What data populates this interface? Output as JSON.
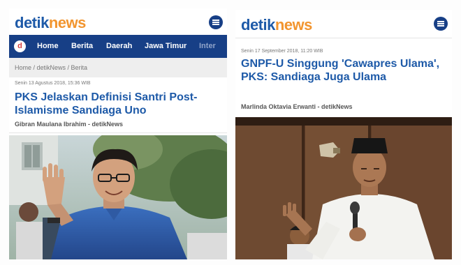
{
  "left_article": {
    "logo": {
      "detik": "detik",
      "news": "news"
    },
    "nav": {
      "logo_letter": "d",
      "items": [
        "Home",
        "Berita",
        "Daerah",
        "Jawa Timur",
        "Inter"
      ]
    },
    "breadcrumb": "Home / detikNews / Berita",
    "date": "Senin 13 Agustus 2018, 15:36 WIB",
    "headline": "PKS Jelaskan Definisi Santri Post-Islamisme Sandiaga Uno",
    "author": "Gibran Maulana Ibrahim - detikNews",
    "photo": "photo of smiling man in blue polo shirt waving"
  },
  "right_article": {
    "logo": {
      "detik": "detik",
      "news": "news"
    },
    "date": "Senin 17 September 2018, 11:20 WIB",
    "headline": "GNPF-U Singgung 'Cawapres Ulama', PKS: Sandiaga Juga Ulama",
    "author": "Marlinda Oktavia Erwanti - detikNews",
    "photo": "photo of man in white clothing and black cap speaking into microphone"
  },
  "colors": {
    "brand_blue": "#1e5aa8",
    "brand_orange": "#f2952f",
    "navbar_blue": "#173f86"
  },
  "icons": [
    "menu-icon",
    "detik-logo-icon"
  ]
}
